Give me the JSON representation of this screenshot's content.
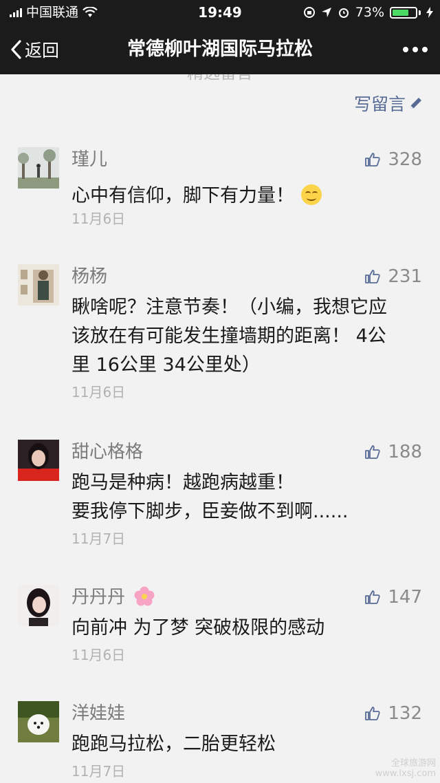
{
  "status": {
    "carrier": "中国联通",
    "time": "19:49",
    "battery": "73%",
    "battery_level": 0.73
  },
  "nav": {
    "back_label": "返回",
    "title": "常德柳叶湖国际马拉松"
  },
  "section": {
    "peek_label": "精选留言",
    "write_label": "写留言"
  },
  "comments": [
    {
      "name": "瑾儿",
      "likes": "328",
      "lines": [
        "心中有信仰，脚下有力量！"
      ],
      "date": "11月6日"
    },
    {
      "name": "杨杨",
      "likes": "231",
      "lines": [
        "瞅啥呢？注意节奏！（小编，我想它应",
        "该放在有可能发生撞墙期的距离！ 4公",
        "里 16公里 34公里处）"
      ],
      "date": "11月6日"
    },
    {
      "name": "甜心格格",
      "likes": "188",
      "lines": [
        "跑马是种病！越跑病越重！",
        "要我停下脚步，臣妾做不到啊......"
      ],
      "date": "11月7日"
    },
    {
      "name": "丹丹丹",
      "likes": "147",
      "lines": [
        "向前冲 为了梦 突破极限的感动"
      ],
      "date": "11月6日"
    },
    {
      "name": "洋娃娃",
      "likes": "132",
      "lines": [
        "跑跑马拉松，二胎更轻松"
      ],
      "date": "11月7日"
    }
  ],
  "watermark": {
    "line1": "全球旅游网",
    "line2": "www.lxsj.com"
  },
  "colors": {
    "link": "#576b95",
    "topbar": "#1b1b1c",
    "background": "#f2f2f2",
    "battery": "#4cd964"
  }
}
